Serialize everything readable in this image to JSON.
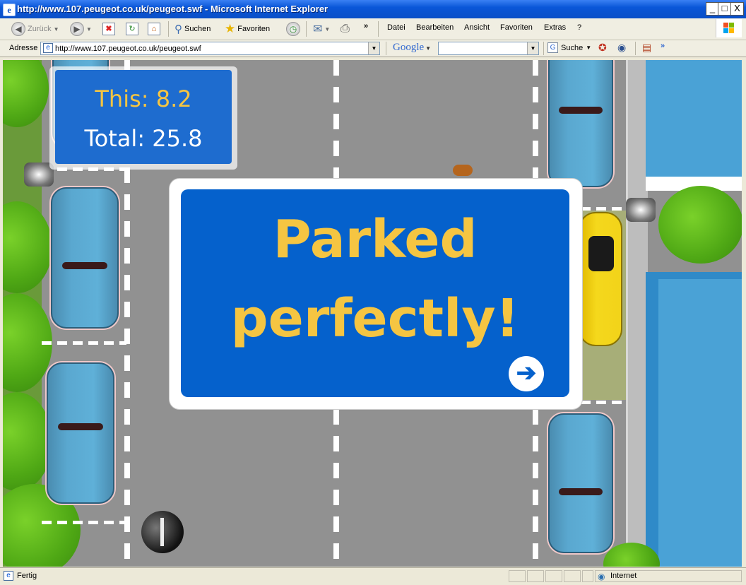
{
  "window": {
    "title": "http://www.107.peugeot.co.uk/peugeot.swf - Microsoft Internet Explorer",
    "minimize": "_",
    "maximize": "□",
    "close": "X"
  },
  "toolbar": {
    "back_label": "Zurück",
    "search_label": "Suchen",
    "favorites_label": "Favoriten",
    "more": "»"
  },
  "menu": [
    "Datei",
    "Bearbeiten",
    "Ansicht",
    "Favoriten",
    "Extras",
    "?"
  ],
  "address": {
    "label": "Adresse",
    "url": "http://www.107.peugeot.co.uk/peugeot.swf"
  },
  "google_bar": {
    "logo": "Google",
    "search_value": "",
    "suche_label": "Suche",
    "more": "»"
  },
  "game": {
    "score_this": "This: 8.2",
    "score_total": "Total: 25.8",
    "message_line1": "Parked",
    "message_line2": "perfectly!",
    "next_icon": "arrow-right-circle-icon"
  },
  "status": {
    "text": "Fertig",
    "zone": "Internet"
  },
  "colors": {
    "ie_blue": "#0a56d8",
    "sign_blue": "#0561cc",
    "score_yellow": "#f5c542",
    "player_car": "#f2d31a",
    "parked_car": "#5aa8d0",
    "tree_green": "#4fa815"
  }
}
